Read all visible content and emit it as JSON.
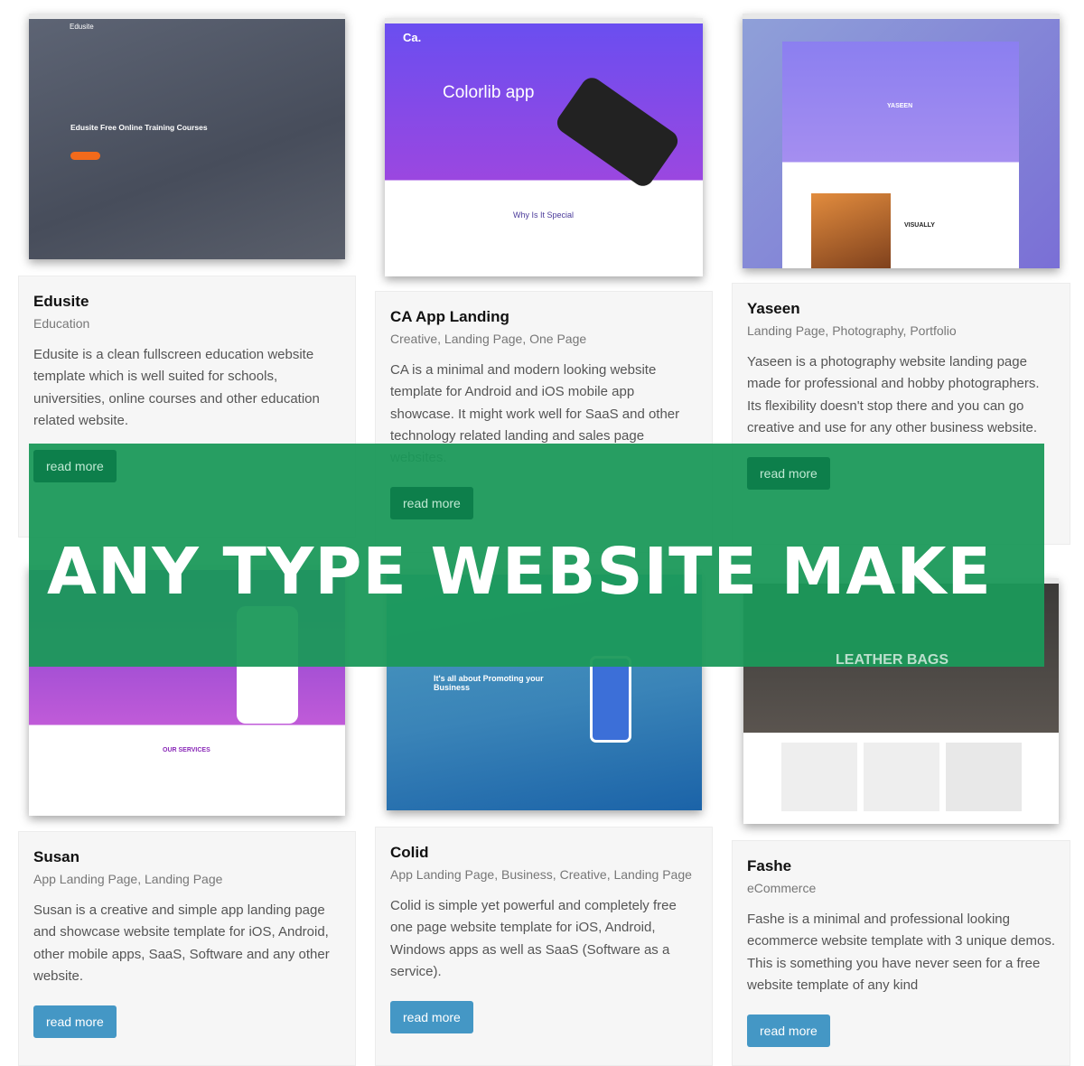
{
  "cards": [
    {
      "title": "Edusite",
      "category": "Education",
      "description": "Edusite is a clean fullscreen education website template which is well suited for schools, universities, online courses and other education related website.",
      "button": "read more",
      "thumb": {
        "brand": "Edusite",
        "headline": "Edusite Free Online Training Courses"
      }
    },
    {
      "title": "CA App Landing",
      "category": "Creative, Landing Page, One Page",
      "description": "CA is a minimal and modern looking website template for Android and iOS mobile app showcase. It might work well for SaaS and other technology related landing and sales page websites.",
      "button": "read more",
      "thumb": {
        "brand": "Ca.",
        "headline": "Colorlib app",
        "sub": "Why Is It Special"
      }
    },
    {
      "title": "Yaseen",
      "category": "Landing Page, Photography, Portfolio",
      "description": "Yaseen is a photography website landing page made for professional and hobby photographers. Its flexibility doesn't stop there and you can go creative and use for any other business website.",
      "button": "read more",
      "thumb": {
        "headline": "YASEEN",
        "sub": "VISUALLY"
      }
    },
    {
      "title": "Susan",
      "category": "App Landing Page, Landing Page",
      "description": "Susan is a creative and simple app landing page and showcase website template for iOS, Android, other mobile apps, SaaS, Software and any other website.",
      "button": "read more",
      "thumb": {
        "sub": "OUR SERVICES"
      }
    },
    {
      "title": "Colid",
      "category": "App Landing Page, Business, Creative, Landing Page",
      "description": "Colid is simple yet powerful and completely free one page website template for iOS, Android, Windows apps as well as SaaS (Software as a service).",
      "button": "read more",
      "thumb": {
        "headline": "It's all about Promoting your Business"
      }
    },
    {
      "title": "Fashe",
      "category": "eCommerce",
      "description": "Fashe is a minimal and professional looking ecommerce website template with 3 unique demos. This is something you have never seen for a free website template of any kind",
      "button": "read more",
      "thumb": {
        "headline": "LEATHER BAGS"
      }
    }
  ],
  "banner": {
    "text": "ANY TYPE WEBSITE MAKE",
    "color": "#1b995a"
  },
  "colors": {
    "button": "#4497c5"
  }
}
